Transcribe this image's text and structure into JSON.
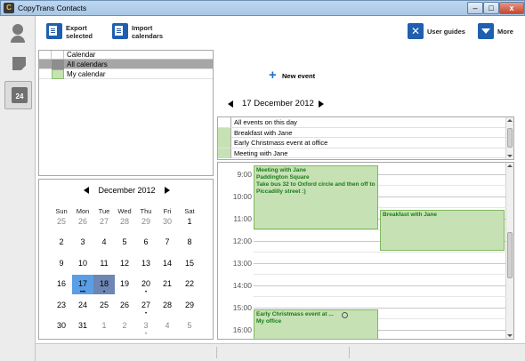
{
  "window": {
    "title": "CopyTrans Contacts",
    "app_icon": "C",
    "controls": {
      "minimize": "–",
      "maximize": "□",
      "close": "x"
    }
  },
  "sidebar": {
    "items": [
      {
        "icon": "person-icon",
        "label": ""
      },
      {
        "icon": "note-icon",
        "label": ""
      },
      {
        "icon": "calendar-icon",
        "label": "24"
      }
    ]
  },
  "toolbar": {
    "export_label": "Export\nselected",
    "import_label": "Import\ncalendars",
    "guides_label": "User guides",
    "more_label": "More"
  },
  "calendars": {
    "header": "Calendar",
    "rows": [
      {
        "name": "All calendars",
        "color": ""
      },
      {
        "name": "My calendar",
        "color": "#c6e2b4"
      }
    ]
  },
  "mini_calendar": {
    "month_label": "December 2012",
    "weekdays": [
      "Sun",
      "Mon",
      "Tue",
      "Wed",
      "Thu",
      "Fri",
      "Sat"
    ],
    "weeks": [
      [
        [
          "25",
          "other",
          ""
        ],
        [
          "26",
          "other",
          ""
        ],
        [
          "27",
          "other",
          ""
        ],
        [
          "28",
          "other",
          ""
        ],
        [
          "29",
          "other",
          ""
        ],
        [
          "30",
          "other",
          ""
        ],
        [
          "1",
          "",
          ""
        ]
      ],
      [
        [
          "2",
          "",
          ""
        ],
        [
          "3",
          "",
          ""
        ],
        [
          "4",
          "",
          ""
        ],
        [
          "5",
          "",
          ""
        ],
        [
          "6",
          "",
          ""
        ],
        [
          "7",
          "",
          ""
        ],
        [
          "8",
          "",
          ""
        ]
      ],
      [
        [
          "9",
          "",
          ""
        ],
        [
          "10",
          "",
          ""
        ],
        [
          "11",
          "",
          ""
        ],
        [
          "12",
          "",
          ""
        ],
        [
          "13",
          "",
          ""
        ],
        [
          "14",
          "",
          ""
        ],
        [
          "15",
          "",
          ""
        ]
      ],
      [
        [
          "16",
          "",
          ""
        ],
        [
          "17",
          "today",
          "•••"
        ],
        [
          "18",
          "selected",
          "•"
        ],
        [
          "19",
          "",
          ""
        ],
        [
          "20",
          "",
          "•"
        ],
        [
          "21",
          "",
          ""
        ],
        [
          "22",
          "",
          ""
        ]
      ],
      [
        [
          "23",
          "",
          ""
        ],
        [
          "24",
          "",
          ""
        ],
        [
          "25",
          "",
          ""
        ],
        [
          "26",
          "",
          ""
        ],
        [
          "27",
          "",
          "•"
        ],
        [
          "28",
          "",
          ""
        ],
        [
          "29",
          "",
          ""
        ]
      ],
      [
        [
          "30",
          "",
          ""
        ],
        [
          "31",
          "",
          ""
        ],
        [
          "1",
          "other",
          ""
        ],
        [
          "2",
          "other",
          ""
        ],
        [
          "3",
          "other",
          "•"
        ],
        [
          "4",
          "other",
          ""
        ],
        [
          "5",
          "other",
          ""
        ]
      ]
    ]
  },
  "day_view": {
    "date_label": "17 December 2012",
    "new_event_label": "New event",
    "all_events_header": "All events on this day",
    "all_events": [
      "Breakfast with Jane",
      "Early Christmass event at office",
      "Meeting with Jane"
    ],
    "hours": [
      "9:00",
      "10:00",
      "11:00",
      "12:00",
      "13:00",
      "14:00",
      "15:00",
      "16:00"
    ],
    "events": [
      {
        "text": "Meeting with Jane\nPaddington Square\nTake bus 32 to Oxford circle and then off to Piccadilly street :)",
        "alarm": false
      },
      {
        "text": "Breakfast with Jane",
        "alarm": false
      },
      {
        "text": "Early Christmass event at ...\nMy office",
        "alarm": true
      }
    ]
  },
  "colors": {
    "event_fill": "#c6e2b4",
    "event_border": "#7fb85e",
    "today": "#5b9ee6",
    "selected": "#6d86b3",
    "accent": "#1f5fb0"
  }
}
